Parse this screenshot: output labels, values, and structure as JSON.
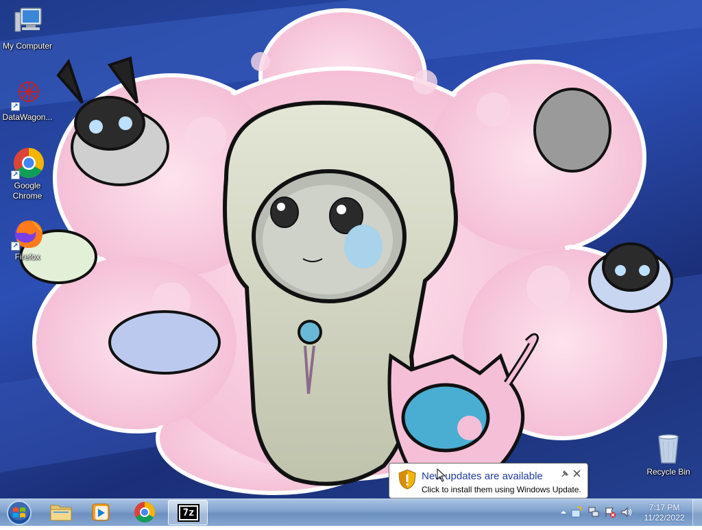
{
  "desktop_icons": [
    {
      "label": "My Computer",
      "icon": "computer-icon"
    },
    {
      "label": "DataWagon...",
      "icon": "datawagon-icon"
    },
    {
      "label": "Google Chrome",
      "icon": "chrome-icon"
    },
    {
      "label": "Firefox",
      "icon": "firefox-icon"
    },
    {
      "label": "Recycle Bin",
      "icon": "recycle-bin-icon"
    }
  ],
  "taskbar": {
    "pinned": [
      {
        "name": "file-explorer",
        "icon": "folder-icon"
      },
      {
        "name": "media-player",
        "icon": "media-player-icon"
      },
      {
        "name": "chrome",
        "icon": "chrome-icon"
      },
      {
        "name": "7zip",
        "icon": "7zip-icon",
        "label": "7z",
        "active": true
      }
    ]
  },
  "tray": {
    "time": "7:17 PM",
    "date": "11/22/2022"
  },
  "notification": {
    "title": "New updates are available",
    "message": "Click to install them using Windows Update."
  },
  "colors": {
    "taskbar": "#7fa1cc",
    "balloon_title": "#1e3d9a",
    "wallpaper_blue": "#2c4fb5",
    "wallpaper_pink": "#f6c8dc"
  }
}
